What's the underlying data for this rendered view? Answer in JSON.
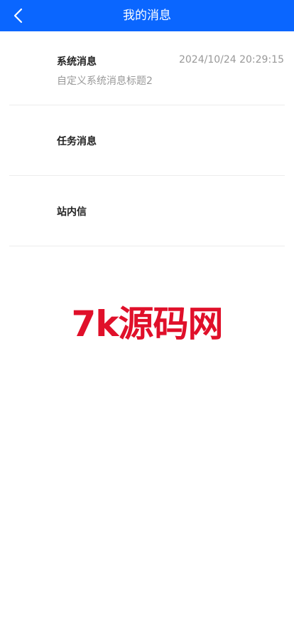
{
  "header": {
    "title": "我的消息",
    "back_icon": "chevron-left-icon"
  },
  "messages": [
    {
      "title": "系统消息",
      "time": "2024/10/24 20:29:15",
      "subtitle": "自定义系统消息标题2"
    },
    {
      "title": "任务消息"
    },
    {
      "title": "站内信"
    }
  ],
  "watermark": "7k源码网",
  "colors": {
    "navbar": "#0a66ff",
    "watermark": "#e0102a",
    "muted_text": "#999999"
  }
}
